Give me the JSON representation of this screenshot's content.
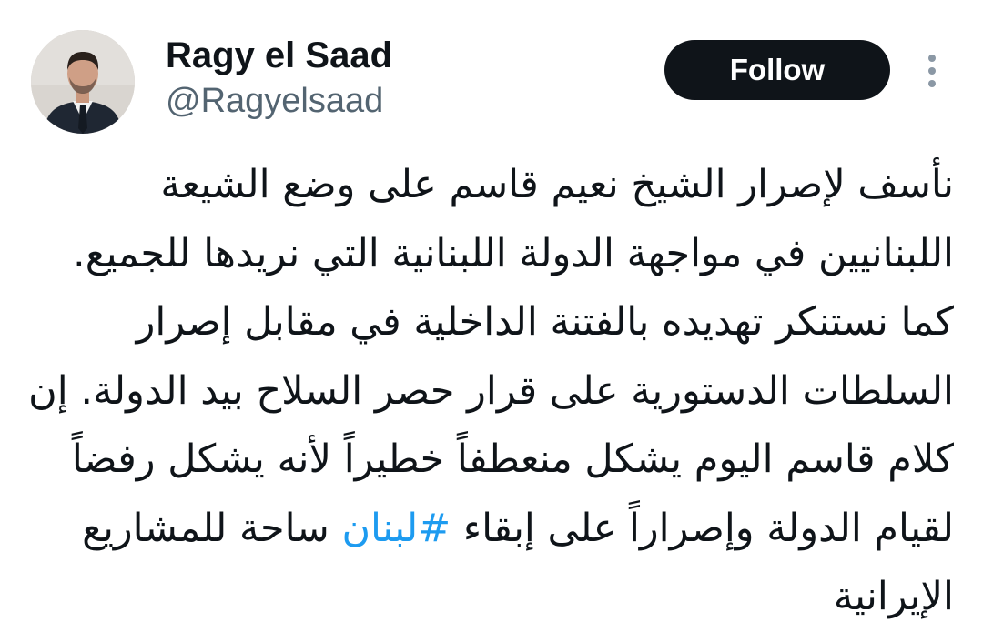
{
  "user": {
    "name": "Ragy el Saad",
    "handle": "@Ragyelsaad"
  },
  "actions": {
    "follow_label": "Follow",
    "more_icon": "more-vertical-icon"
  },
  "tweet": {
    "lines": [
      "نأسف لإصرار الشيخ نعيم قاسم على وضع الشيعة",
      "اللبنانيين في مواجهة الدولة اللبنانية التي نريدها للجميع.",
      "كما نستنكر تهديده بالفتنة الداخلية في مقابل إصرار",
      "السلطات الدستورية على قرار حصر السلاح بيد الدولة. إن",
      "كلام قاسم اليوم يشكل منعطفاً خطيراً لأنه يشكل رفضاً",
      "لقيام الدولة وإصراراً على إبقاء",
      "ساحة للمشاريع",
      "الإيرانية"
    ],
    "hashtag": "#لبنان"
  },
  "colors": {
    "text": "#0f1419",
    "secondary_text": "#536471",
    "link": "#1d9bf0",
    "follow_bg": "#0f1419",
    "follow_text": "#ffffff",
    "more_icon": "#8b98a5"
  }
}
